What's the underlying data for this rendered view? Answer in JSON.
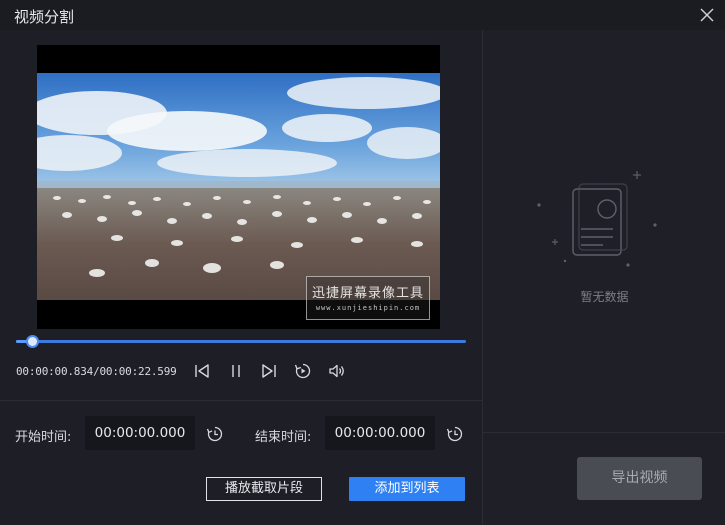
{
  "window": {
    "title": "视频分割"
  },
  "player": {
    "watermark_cn": "迅捷屏幕录像工具",
    "watermark_en": "www.xunjieshipin.com",
    "current_time": "00:00:00.834",
    "total_time": "00:00:22.599",
    "time_display": "00:00:00.834/00:00:22.599",
    "progress_fraction": 0.037
  },
  "range": {
    "start_label": "开始时间:",
    "start_value": "00:00:00.000",
    "end_label": "结束时间:",
    "end_value": "00:00:00.000"
  },
  "actions": {
    "play_segment_label": "播放截取片段",
    "add_to_list_label": "添加到列表"
  },
  "list_panel": {
    "empty_text": "暂无数据",
    "export_label": "导出视频"
  },
  "colors": {
    "accent": "#2f80f2",
    "background": "#1e1f26",
    "field_bg": "#16171c",
    "export_disabled": "#4a4c54"
  },
  "icons": [
    "close-icon",
    "skip-back-icon",
    "pause-icon",
    "skip-forward-icon",
    "replay-icon",
    "volume-icon",
    "clock-reset-icon",
    "empty-document-icon"
  ]
}
